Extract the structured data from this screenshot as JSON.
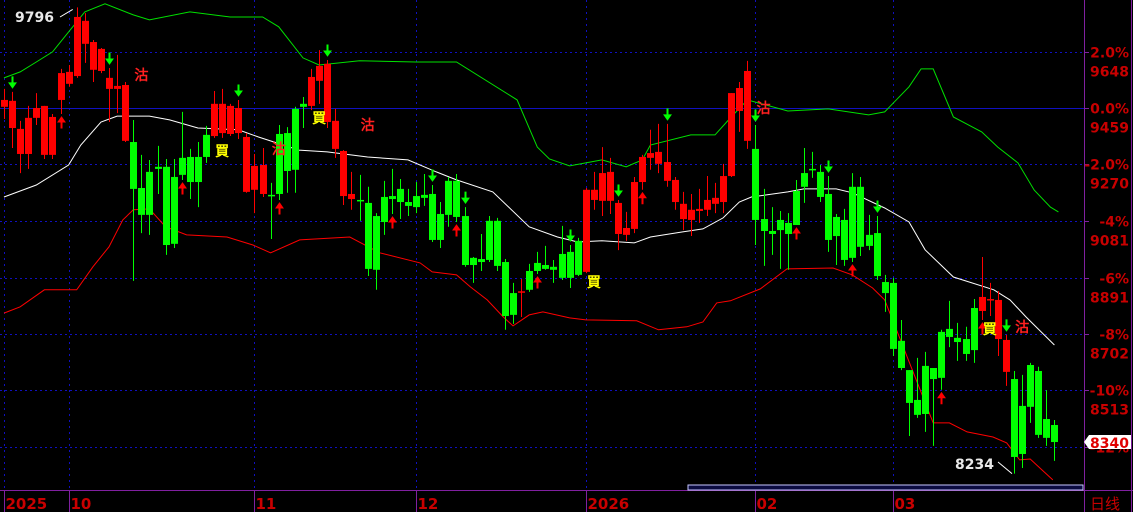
{
  "chart_data": {
    "type": "candlestick",
    "period_label": "日线",
    "price_range": [
      8180,
      9830
    ],
    "base_price": 9459,
    "y_axis": [
      {
        "pct": "2.0%",
        "price": "9648",
        "value": 9648
      },
      {
        "pct": "0.0%",
        "price": "9459",
        "value": 9459
      },
      {
        "pct": "-2.0%",
        "price": "9270",
        "value": 9270
      },
      {
        "pct": "-4%",
        "price": "9081",
        "value": 9081
      },
      {
        "pct": "-6%",
        "price": "8891",
        "value": 8891
      },
      {
        "pct": "-8%",
        "price": "8702",
        "value": 8702
      },
      {
        "pct": "-10%",
        "price": "8513",
        "value": 8513
      },
      {
        "pct": "-12%",
        "price": "",
        "value": 8324
      }
    ],
    "x_axis": [
      {
        "label": "2025",
        "index": 0
      },
      {
        "label": "10",
        "index": 8
      },
      {
        "label": "11",
        "index": 31
      },
      {
        "label": "12",
        "index": 51
      },
      {
        "label": "2026",
        "index": 72
      },
      {
        "label": "02",
        "index": 93
      },
      {
        "label": "03",
        "index": 110
      }
    ],
    "last_price": "8340",
    "high_label": {
      "text": "9796",
      "index": 9,
      "value": 9796
    },
    "low_label": {
      "text": "8234",
      "index": 125,
      "value": 8234
    },
    "colors": {
      "up": "#ff0000",
      "down": "#00ff00",
      "upper_band": "#00e000",
      "mid_band": "#ffffff",
      "lower_band": "#ff0000",
      "grid": "#1010c0",
      "axis_text": "#c80000",
      "buy": "#ffff00",
      "sell": "#ff2020"
    },
    "candles_ohlc": [
      [
        9463,
        9523,
        9422,
        9486
      ],
      [
        9392,
        9513,
        9325,
        9483
      ],
      [
        9305,
        9416,
        9241,
        9389
      ],
      [
        9305,
        9466,
        9255,
        9426
      ],
      [
        9426,
        9509,
        9402,
        9459
      ],
      [
        9302,
        9466,
        9288,
        9466
      ],
      [
        9302,
        9439,
        9288,
        9429
      ],
      [
        9486,
        9590,
        9439,
        9576
      ],
      [
        9540,
        9603,
        9530,
        9580
      ],
      [
        9566,
        9796,
        9560,
        9764
      ],
      [
        9674,
        9777,
        9610,
        9751
      ],
      [
        9587,
        9687,
        9546,
        9680
      ],
      [
        9583,
        9660,
        9576,
        9657
      ],
      [
        9523,
        9593,
        9412,
        9560
      ],
      [
        9523,
        9637,
        9442,
        9533
      ],
      [
        9349,
        9546,
        9345,
        9536
      ],
      [
        9345,
        9419,
        8880,
        9188
      ],
      [
        9191,
        9302,
        9040,
        9101
      ],
      [
        9245,
        9285,
        9034,
        9101
      ],
      [
        9262,
        9332,
        9171,
        9255
      ],
      [
        9262,
        9288,
        8967,
        9000
      ],
      [
        9228,
        9288,
        8990,
        9004
      ],
      [
        9292,
        9446,
        9218,
        9235
      ],
      [
        9295,
        9322,
        9154,
        9211
      ],
      [
        9295,
        9345,
        9127,
        9211
      ],
      [
        9369,
        9399,
        9275,
        9295
      ],
      [
        9365,
        9516,
        9359,
        9473
      ],
      [
        9375,
        9523,
        9359,
        9473
      ],
      [
        9372,
        9473,
        9365,
        9466
      ],
      [
        9375,
        9486,
        9355,
        9459
      ],
      [
        9178,
        9375,
        9175,
        9362
      ],
      [
        9185,
        9305,
        9107,
        9265
      ],
      [
        9171,
        9325,
        9161,
        9268
      ],
      [
        9168,
        9208,
        9020,
        9165
      ],
      [
        9372,
        9402,
        9151,
        9171
      ],
      [
        9375,
        9395,
        9175,
        9248
      ],
      [
        9456,
        9463,
        9175,
        9252
      ],
      [
        9473,
        9496,
        9392,
        9463
      ],
      [
        9466,
        9590,
        9452,
        9563
      ],
      [
        9550,
        9653,
        9473,
        9600
      ],
      [
        9412,
        9620,
        9392,
        9607
      ],
      [
        9322,
        9456,
        9292,
        9416
      ],
      [
        9164,
        9318,
        9134,
        9315
      ],
      [
        9154,
        9245,
        9118,
        9171
      ],
      [
        9151,
        9235,
        9081,
        9148
      ],
      [
        9141,
        9195,
        8896,
        8920
      ],
      [
        9097,
        9107,
        8850,
        8917
      ],
      [
        9161,
        9215,
        9034,
        9077
      ],
      [
        9164,
        9255,
        9104,
        9154
      ],
      [
        9188,
        9221,
        9087,
        9144
      ],
      [
        9144,
        9188,
        9097,
        9131
      ],
      [
        9164,
        9211,
        9107,
        9127
      ],
      [
        9168,
        9238,
        9131,
        9158
      ],
      [
        9171,
        9201,
        9010,
        9017
      ],
      [
        9104,
        9144,
        8990,
        9017
      ],
      [
        9215,
        9228,
        9061,
        9101
      ],
      [
        9215,
        9238,
        9077,
        9094
      ],
      [
        9097,
        9127,
        8927,
        8933
      ],
      [
        8957,
        8960,
        8873,
        8933
      ],
      [
        8953,
        9037,
        8913,
        8943
      ],
      [
        9081,
        9097,
        8943,
        8950
      ],
      [
        9081,
        9091,
        8913,
        8930
      ],
      [
        8943,
        8953,
        8716,
        8762
      ],
      [
        8839,
        8873,
        8736,
        8766
      ],
      [
        8843,
        8886,
        8759,
        8845
      ],
      [
        8913,
        8937,
        8843,
        8850
      ],
      [
        8940,
        8977,
        8903,
        8913
      ],
      [
        8933,
        8997,
        8917,
        8920
      ],
      [
        8927,
        8950,
        8873,
        8917
      ],
      [
        8970,
        9064,
        8883,
        8890
      ],
      [
        8977,
        9000,
        8856,
        8890
      ],
      [
        9014,
        9024,
        8896,
        8900
      ],
      [
        8910,
        9191,
        8906,
        9185
      ],
      [
        9151,
        9245,
        9118,
        9185
      ],
      [
        9148,
        9328,
        9097,
        9241
      ],
      [
        9148,
        9292,
        9104,
        9245
      ],
      [
        9037,
        9151,
        8983,
        9141
      ],
      [
        9034,
        9111,
        9014,
        9057
      ],
      [
        9054,
        9228,
        9040,
        9211
      ],
      [
        9211,
        9302,
        9185,
        9295
      ],
      [
        9292,
        9386,
        9252,
        9308
      ],
      [
        9272,
        9406,
        9241,
        9312
      ],
      [
        9215,
        9406,
        9195,
        9278
      ],
      [
        9144,
        9228,
        9118,
        9218
      ],
      [
        9087,
        9178,
        9050,
        9138
      ],
      [
        9084,
        9171,
        9030,
        9118
      ],
      [
        9114,
        9188,
        9074,
        9121
      ],
      [
        9118,
        9231,
        9097,
        9151
      ],
      [
        9138,
        9208,
        9107,
        9158
      ],
      [
        9144,
        9272,
        9107,
        9231
      ],
      [
        9231,
        9509,
        9228,
        9509
      ],
      [
        9449,
        9546,
        9379,
        9526
      ],
      [
        9349,
        9617,
        9322,
        9583
      ],
      [
        9322,
        9402,
        9000,
        9084
      ],
      [
        9087,
        9188,
        8930,
        9047
      ],
      [
        9047,
        9127,
        8967,
        9037
      ],
      [
        9084,
        9114,
        8920,
        9050
      ],
      [
        9074,
        9107,
        8917,
        9037
      ],
      [
        9181,
        9218,
        9067,
        9067
      ],
      [
        9241,
        9325,
        9141,
        9195
      ],
      [
        9255,
        9312,
        9225,
        9252
      ],
      [
        9245,
        9268,
        9144,
        9161
      ],
      [
        9171,
        9231,
        8977,
        9017
      ],
      [
        9094,
        9104,
        8933,
        9030
      ],
      [
        9084,
        9121,
        8930,
        8950
      ],
      [
        9195,
        9241,
        8943,
        8957
      ],
      [
        9195,
        9228,
        8963,
        8994
      ],
      [
        9034,
        9101,
        8983,
        8997
      ],
      [
        9040,
        9097,
        8883,
        8896
      ],
      [
        8876,
        8900,
        8776,
        8839
      ],
      [
        8873,
        8890,
        8628,
        8652
      ],
      [
        8679,
        8749,
        8581,
        8588
      ],
      [
        8581,
        8581,
        8360,
        8471
      ],
      [
        8481,
        8622,
        8421,
        8431
      ],
      [
        8595,
        8642,
        8374,
        8434
      ],
      [
        8588,
        8588,
        8327,
        8551
      ],
      [
        8709,
        8716,
        8515,
        8555
      ],
      [
        8719,
        8813,
        8658,
        8692
      ],
      [
        8689,
        8739,
        8612,
        8675
      ],
      [
        8685,
        8726,
        8612,
        8635
      ],
      [
        8789,
        8819,
        8605,
        8648
      ],
      [
        8779,
        8960,
        8749,
        8826
      ],
      [
        8819,
        8873,
        8762,
        8819
      ],
      [
        8685,
        8846,
        8628,
        8816
      ],
      [
        8575,
        8699,
        8528,
        8682
      ],
      [
        8551,
        8578,
        8234,
        8290
      ],
      [
        8461,
        8565,
        8253,
        8300
      ],
      [
        8598,
        8605,
        8404,
        8458
      ],
      [
        8578,
        8592,
        8354,
        8364
      ],
      [
        8417,
        8514,
        8327,
        8354
      ],
      [
        8397,
        8414,
        8277,
        8340
      ]
    ],
    "upper_band": [
      [
        0,
        9560
      ],
      [
        2,
        9580
      ],
      [
        4,
        9613
      ],
      [
        6,
        9647
      ],
      [
        8,
        9714
      ],
      [
        10,
        9781
      ],
      [
        12.5,
        9808
      ],
      [
        16,
        9771
      ],
      [
        18,
        9754
      ],
      [
        23,
        9781
      ],
      [
        28,
        9764
      ],
      [
        32,
        9764
      ],
      [
        34,
        9731
      ],
      [
        37,
        9627
      ],
      [
        39,
        9603
      ],
      [
        44,
        9617
      ],
      [
        51,
        9613
      ],
      [
        56,
        9613
      ],
      [
        63.5,
        9486
      ],
      [
        66,
        9328
      ],
      [
        67.5,
        9288
      ],
      [
        70,
        9265
      ],
      [
        72,
        9275
      ],
      [
        74,
        9285
      ],
      [
        77,
        9262
      ],
      [
        79,
        9285
      ],
      [
        80,
        9335
      ],
      [
        85,
        9369
      ],
      [
        88,
        9369
      ],
      [
        90,
        9429
      ],
      [
        92,
        9486
      ],
      [
        97,
        9449
      ],
      [
        102,
        9456
      ],
      [
        107,
        9436
      ],
      [
        109,
        9446
      ],
      [
        112,
        9530
      ],
      [
        113.5,
        9590
      ],
      [
        115,
        9590
      ],
      [
        117.5,
        9429
      ],
      [
        121,
        9379
      ],
      [
        123,
        9328
      ],
      [
        125.5,
        9275
      ],
      [
        127.5,
        9184
      ],
      [
        129.5,
        9127
      ],
      [
        130.5,
        9111
      ]
    ],
    "mid_band": [
      [
        0,
        9161
      ],
      [
        4,
        9201
      ],
      [
        8,
        9268
      ],
      [
        9.5,
        9335
      ],
      [
        12,
        9412
      ],
      [
        14,
        9432
      ],
      [
        18,
        9432
      ],
      [
        20.5,
        9419
      ],
      [
        24,
        9392
      ],
      [
        29,
        9386
      ],
      [
        31.5,
        9362
      ],
      [
        36.5,
        9318
      ],
      [
        40,
        9312
      ],
      [
        45,
        9295
      ],
      [
        50,
        9285
      ],
      [
        53.5,
        9245
      ],
      [
        56,
        9218
      ],
      [
        60.5,
        9178
      ],
      [
        65,
        9061
      ],
      [
        68.5,
        9027
      ],
      [
        71,
        9010
      ],
      [
        74,
        9014
      ],
      [
        78,
        9007
      ],
      [
        80,
        9027
      ],
      [
        84,
        9044
      ],
      [
        86.5,
        9054
      ],
      [
        89,
        9091
      ],
      [
        91,
        9144
      ],
      [
        92.5,
        9161
      ],
      [
        97,
        9178
      ],
      [
        99,
        9188
      ],
      [
        103,
        9188
      ],
      [
        105,
        9175
      ],
      [
        109,
        9124
      ],
      [
        112,
        9077
      ],
      [
        114,
        8984
      ],
      [
        117.5,
        8893
      ],
      [
        122.5,
        8850
      ],
      [
        124.5,
        8816
      ],
      [
        126.5,
        8759
      ],
      [
        130,
        8665
      ]
    ],
    "lower_band": [
      [
        0,
        8772
      ],
      [
        2,
        8793
      ],
      [
        5,
        8850
      ],
      [
        9,
        8850
      ],
      [
        11,
        8927
      ],
      [
        13,
        8994
      ],
      [
        14.7,
        9084
      ],
      [
        16,
        9118
      ],
      [
        18,
        9121
      ],
      [
        20,
        9061
      ],
      [
        22.6,
        9034
      ],
      [
        27.6,
        9027
      ],
      [
        30.8,
        9000
      ],
      [
        33,
        8974
      ],
      [
        36.6,
        9017
      ],
      [
        42.8,
        9027
      ],
      [
        46.5,
        8974
      ],
      [
        51.5,
        8940
      ],
      [
        53,
        8910
      ],
      [
        56,
        8900
      ],
      [
        57.7,
        8860
      ],
      [
        59.8,
        8816
      ],
      [
        61.8,
        8759
      ],
      [
        63,
        8729
      ],
      [
        65,
        8766
      ],
      [
        66.7,
        8776
      ],
      [
        70,
        8756
      ],
      [
        72,
        8749
      ],
      [
        78.3,
        8746
      ],
      [
        81,
        8716
      ],
      [
        84.5,
        8726
      ],
      [
        86.5,
        8742
      ],
      [
        88.2,
        8806
      ],
      [
        89.9,
        8813
      ],
      [
        93.6,
        8853
      ],
      [
        96.9,
        8920
      ],
      [
        102.6,
        8923
      ],
      [
        105,
        8900
      ],
      [
        107.5,
        8856
      ],
      [
        109,
        8816
      ],
      [
        111.3,
        8658
      ],
      [
        115,
        8404
      ],
      [
        117,
        8404
      ],
      [
        119.2,
        8374
      ],
      [
        122.4,
        8357
      ],
      [
        124.1,
        8337
      ],
      [
        125.7,
        8280
      ],
      [
        127,
        8283
      ],
      [
        128.2,
        8253
      ],
      [
        129.8,
        8213
      ]
    ],
    "down_arrows": [
      1,
      13,
      29,
      40,
      53,
      57,
      70,
      76,
      82,
      93,
      102,
      108,
      124
    ],
    "up_arrows": [
      7,
      22,
      34,
      48,
      56,
      66,
      79,
      98,
      105,
      116,
      121
    ],
    "signals": [
      {
        "type": "sell",
        "label": "沽",
        "index": 17,
        "value": 9573
      },
      {
        "type": "buy",
        "label": "買",
        "index": 27,
        "value": 9318
      },
      {
        "type": "sell",
        "label": "沽",
        "index": 34,
        "value": 9325
      },
      {
        "type": "buy",
        "label": "買",
        "index": 39,
        "value": 9429
      },
      {
        "type": "sell",
        "label": "沽",
        "index": 45,
        "value": 9406
      },
      {
        "type": "buy",
        "label": "買",
        "index": 73,
        "value": 8880
      },
      {
        "type": "sell",
        "label": "沽",
        "index": 94,
        "value": 9462
      },
      {
        "type": "buy",
        "label": "買",
        "index": 122,
        "value": 8722
      },
      {
        "type": "sell",
        "label": "沽",
        "index": 126,
        "value": 8729
      }
    ]
  }
}
